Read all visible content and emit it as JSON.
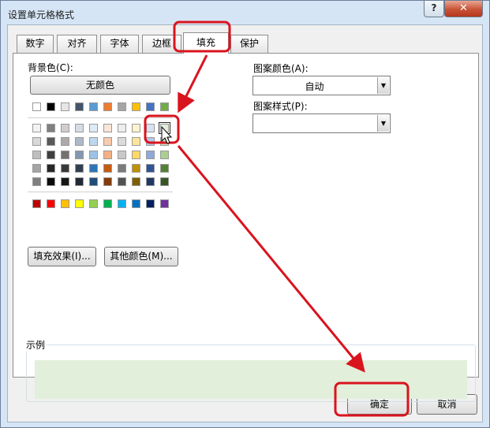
{
  "window": {
    "title": "设置单元格格式",
    "help": "?",
    "close": "✕"
  },
  "tabs": [
    {
      "label": "数字"
    },
    {
      "label": "对齐"
    },
    {
      "label": "字体"
    },
    {
      "label": "边框"
    },
    {
      "label": "填充"
    },
    {
      "label": "保护"
    }
  ],
  "active_tab": "填充",
  "background": {
    "label": "背景色(C):",
    "no_color_button": "无颜色",
    "theme_top_row": [
      "#ffffff",
      "#000000",
      "#e7e6e6",
      "#44546a",
      "#5b9bd5",
      "#ed7d31",
      "#a5a5a5",
      "#ffc000",
      "#4472c4",
      "#70ad47"
    ],
    "tint_rows": [
      [
        "#f2f2f2",
        "#808080",
        "#d0cece",
        "#d6dce4",
        "#deebf6",
        "#fbe5d5",
        "#ededed",
        "#fff2cc",
        "#d9e1f2",
        "#e2efda"
      ],
      [
        "#d8d8d8",
        "#595959",
        "#aeaaaa",
        "#adb9ca",
        "#bdd7ee",
        "#f7cbac",
        "#dbdbdb",
        "#fee599",
        "#b4c6e7",
        "#c6e0b4"
      ],
      [
        "#bfbfbf",
        "#3f3f3f",
        "#757171",
        "#8497b0",
        "#9cc3e5",
        "#f4b183",
        "#c9c9c9",
        "#ffd966",
        "#8ea9db",
        "#a9d08e"
      ],
      [
        "#a5a5a5",
        "#262626",
        "#3a3838",
        "#333f4f",
        "#2e75b5",
        "#c55a11",
        "#7b7b7b",
        "#bf9000",
        "#2f5496",
        "#548235"
      ],
      [
        "#7f7f7f",
        "#0c0c0c",
        "#171616",
        "#222a35",
        "#1f4e79",
        "#843c0b",
        "#525252",
        "#7f6000",
        "#1f3864",
        "#375623"
      ]
    ],
    "standard_row": [
      "#c00000",
      "#ff0000",
      "#ffc000",
      "#ffff00",
      "#92d050",
      "#00b050",
      "#00b0f0",
      "#0070c0",
      "#002060",
      "#7030a0"
    ],
    "fill_effects_button": "填充效果(I)...",
    "more_colors_button": "其他颜色(M)..."
  },
  "pattern": {
    "color_label": "图案颜色(A):",
    "color_value": "自动",
    "style_label": "图案样式(P):",
    "style_value": ""
  },
  "sample": {
    "label": "示例",
    "color": "#e2efda"
  },
  "footer": {
    "ok_button": "确定",
    "cancel_button": "取消"
  },
  "annotation_color": "#d9141e"
}
